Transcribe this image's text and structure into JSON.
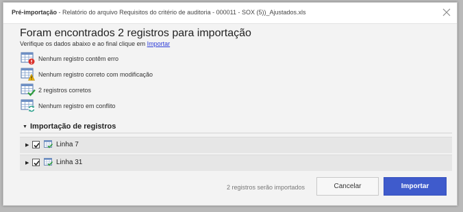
{
  "dialog": {
    "title_strong": "Pré-importação",
    "title_rest": " - Relatório do arquivo Requisitos do critério de auditoria - 000011 - SOX (5))_Ajustados.xls"
  },
  "header": {
    "heading": "Foram encontrados 2 registros para importação",
    "instructions_prefix": "Verifique os dados abaixo e ao final clique em ",
    "instructions_link": "Importar"
  },
  "status": [
    {
      "icon": "table-error-icon",
      "text": "Nenhum registro contêm erro"
    },
    {
      "icon": "table-warning-icon",
      "text": "Nenhum registro correto com modificação"
    },
    {
      "icon": "table-check-icon",
      "text": "2 registros corretos"
    },
    {
      "icon": "table-refresh-icon",
      "text": "Nenhum registro em conflito"
    }
  ],
  "section": {
    "title": "Importação de registros"
  },
  "records": [
    {
      "label": "Linha 7",
      "checked": true
    },
    {
      "label": "Linha 31",
      "checked": true
    }
  ],
  "footer": {
    "info": "2 registros serão importados",
    "cancel_label": "Cancelar",
    "import_label": "Importar"
  },
  "colors": {
    "primary": "#3f5bcc",
    "error": "#d9302a",
    "warning": "#f0b400",
    "success": "#2e9d3a",
    "sync": "#2a9f8a"
  }
}
